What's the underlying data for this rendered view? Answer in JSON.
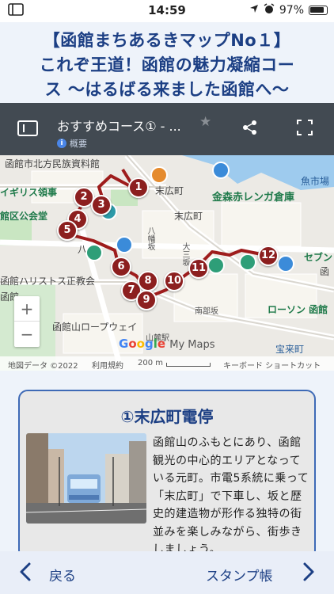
{
  "status_bar": {
    "time": "14:59",
    "battery": "97%",
    "icons": [
      "sidebar-icon",
      "location-arrow-icon",
      "alarm-icon",
      "battery-icon"
    ]
  },
  "page": {
    "title_line1": "【函館まちあるきマップNo１】",
    "title_line2": "これぞ王道！函館の魅力凝縮コー",
    "title_line3": "ス 〜はるばる来ました函館へ〜"
  },
  "map_header": {
    "title": "おすすめコース① - ...",
    "subtitle": "概要",
    "icons": [
      "panel-icon",
      "star-icon",
      "share-icon",
      "fullscreen-icon"
    ]
  },
  "map": {
    "labels": {
      "museum": "函館市北方民族資料館",
      "english_consulate": "イギリス領事",
      "public_hall": "館区公会堂",
      "suehirocho_top": "末広町",
      "suehirocho_mid": "末広町",
      "kanemori": "金森赤レンガ倉庫",
      "uoichiba": "魚市場",
      "hachiman": "八幡坂",
      "daisan": "大三坂",
      "seven": "セブン",
      "hako": "函",
      "haristos": "函館ハリストス正教会",
      "hako_left": "函館",
      "ropeway": "函館山ロープウェイ",
      "sanroku": "山麓駅",
      "nanbuzaka": "南部坂",
      "lawson": "ローソン 函館",
      "horaicho": "宝来町",
      "hachi": "八"
    },
    "markers": [
      "1",
      "2",
      "3",
      "4",
      "5",
      "6",
      "7",
      "8",
      "9",
      "10",
      "11",
      "12"
    ],
    "zoom_in": "+",
    "zoom_out": "−",
    "google": [
      "G",
      "o",
      "o",
      "g",
      "l",
      "e"
    ],
    "mymaps": "My Maps",
    "attribution": {
      "data": "地図データ ©2022",
      "terms": "利用規約",
      "scale": "200 m",
      "shortcuts": "キーボード ショートカット"
    }
  },
  "card": {
    "title": "①末広町電停",
    "text": "函館山のふもとにあり、函館観光の中心的エリアとなっている元町。市電5系統に乗って「末広町」で下車し、坂と歴史的建造物が形作る独特の街並みを楽しみながら、街歩きしましょう。"
  },
  "bottom_nav": {
    "back_label": "戻る",
    "stamp_label": "スタンプ帳"
  },
  "colors": {
    "title_blue": "#1c3f84",
    "map_header": "#424a52",
    "marker_red": "#8c1f1f",
    "card_border": "#3e6ab6"
  }
}
